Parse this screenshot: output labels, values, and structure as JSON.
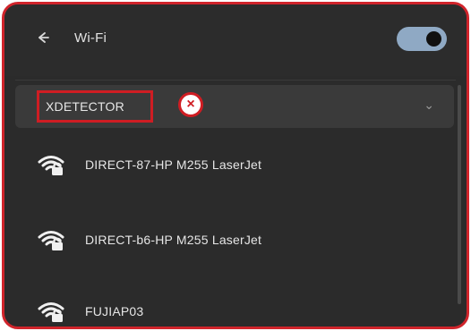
{
  "header": {
    "back_icon": "arrow-left-icon",
    "title": "Wi-Fi",
    "toggle_state": "on"
  },
  "selected_network": {
    "name": "XDETECTOR",
    "badge": "×"
  },
  "networks": [
    {
      "name": "DIRECT-87-HP M255 LaserJet",
      "secured": true
    },
    {
      "name": "DIRECT-b6-HP M255 LaserJet",
      "secured": true
    },
    {
      "name": "FUJIAP03",
      "secured": true
    }
  ],
  "colors": {
    "background": "#2b2b2b",
    "accent_red": "#cf1d23",
    "toggle_on": "#8fa9c4",
    "text": "#e6e6e6"
  }
}
